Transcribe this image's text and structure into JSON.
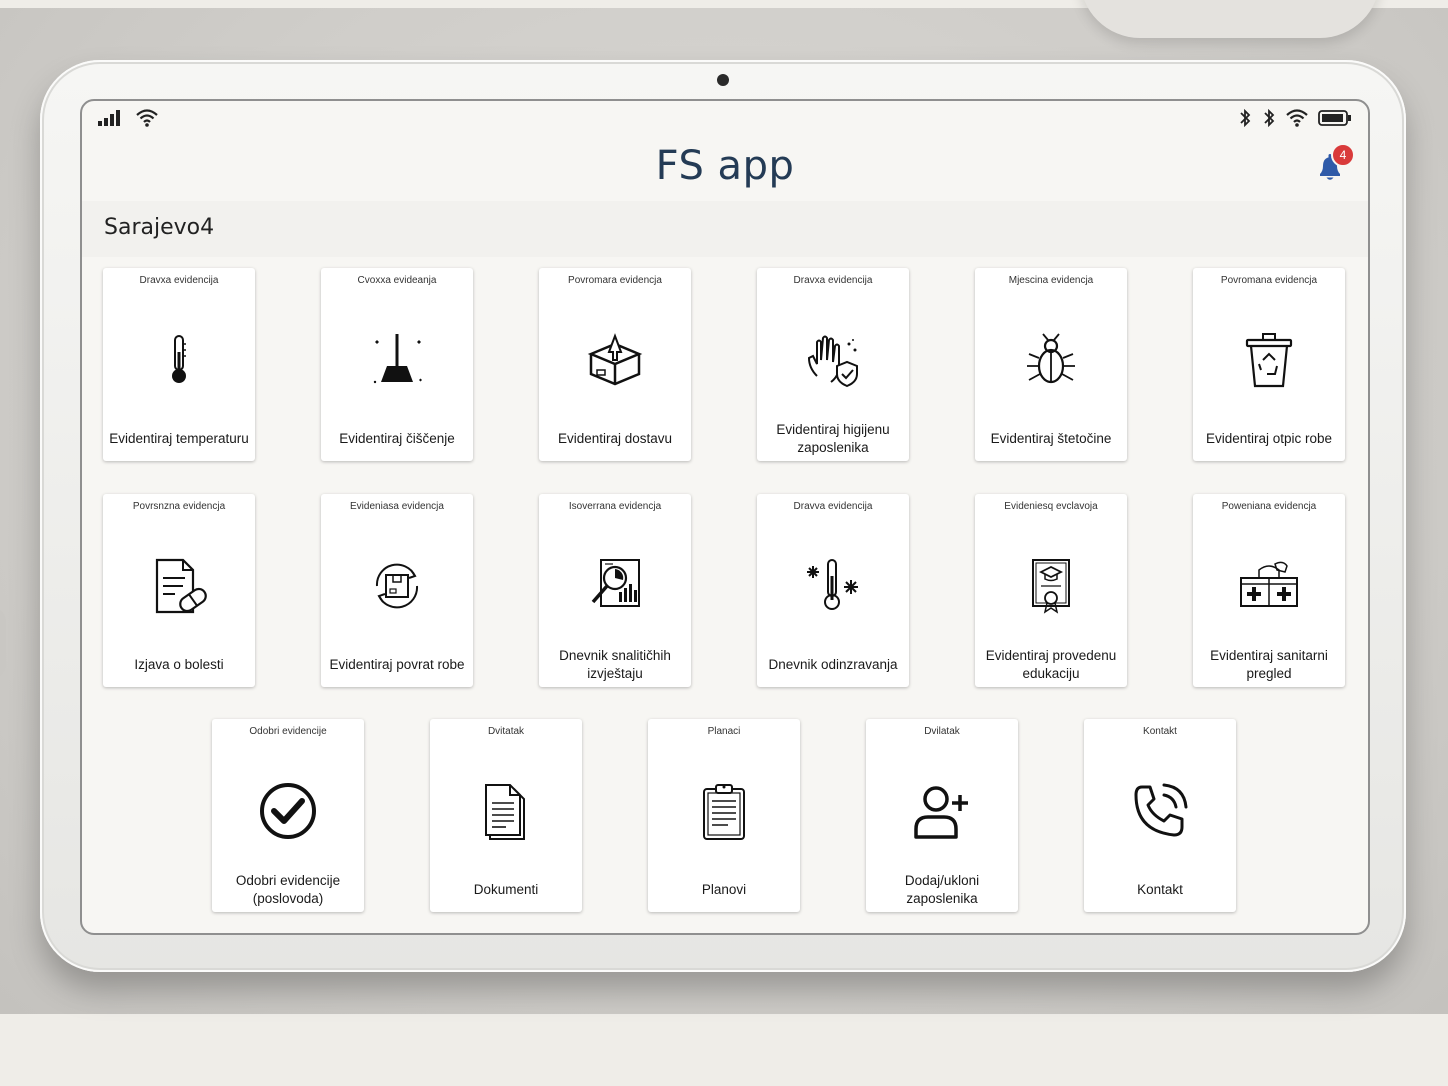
{
  "app": {
    "title": "FS app",
    "notification_count": "4"
  },
  "location": "Sarajevo4",
  "tiles": [
    {
      "category": "Dravxa evidencija",
      "label": "Evidentiraj temperaturu",
      "icon": "thermometer-icon"
    },
    {
      "category": "Cvoxxa evideanja",
      "label": "Evidentiraj čiščenje",
      "icon": "broom-icon"
    },
    {
      "category": "Povromara evidencja",
      "label": "Evidentiraj dostavu",
      "icon": "delivery-box-icon"
    },
    {
      "category": "Dravxa evidencija",
      "label": "Evidentiraj higijenu zaposlenika",
      "icon": "hand-hygiene-icon"
    },
    {
      "category": "Mjescina evidencja",
      "label": "Evidentiraj štetočine",
      "icon": "bug-icon"
    },
    {
      "category": "Povromana evidencja",
      "label": "Evidentiraj otpic robe",
      "icon": "recycle-bin-icon"
    },
    {
      "category": "Povrsnzna evidencja",
      "label": "Izjava o bolesti",
      "icon": "medical-document-icon"
    },
    {
      "category": "Evideniasa evidencja",
      "label": "Evidentiraj povrat robe",
      "icon": "return-box-icon"
    },
    {
      "category": "Isoverrana evidencja",
      "label": "Dnevnik snalitičhih izvještaju",
      "icon": "analytics-report-icon"
    },
    {
      "category": "Dravva evidencija",
      "label": "Dnevnik odinzravanja",
      "icon": "freezer-thermometer-icon"
    },
    {
      "category": "Evideniesq evclavoja",
      "label": "Evidentiraj provedenu edukaciju",
      "icon": "certificate-icon"
    },
    {
      "category": "Poweniana evidencja",
      "label": "Evidentiraj sanitarni pregled",
      "icon": "first-aid-kit-icon"
    },
    {
      "category": "Odobri evidencije",
      "label": "Odobri evidencije (poslovoda)",
      "icon": "checkmark-circle-icon"
    },
    {
      "category": "Dvitatak",
      "label": "Dokumenti",
      "icon": "documents-icon"
    },
    {
      "category": "Planaci",
      "label": "Planovi",
      "icon": "clipboard-icon"
    },
    {
      "category": "Dvilatak",
      "label": "Dodaj/ukloni zaposlenika",
      "icon": "add-user-icon"
    },
    {
      "category": "Kontakt",
      "label": "Kontakt",
      "icon": "phone-icon"
    }
  ]
}
